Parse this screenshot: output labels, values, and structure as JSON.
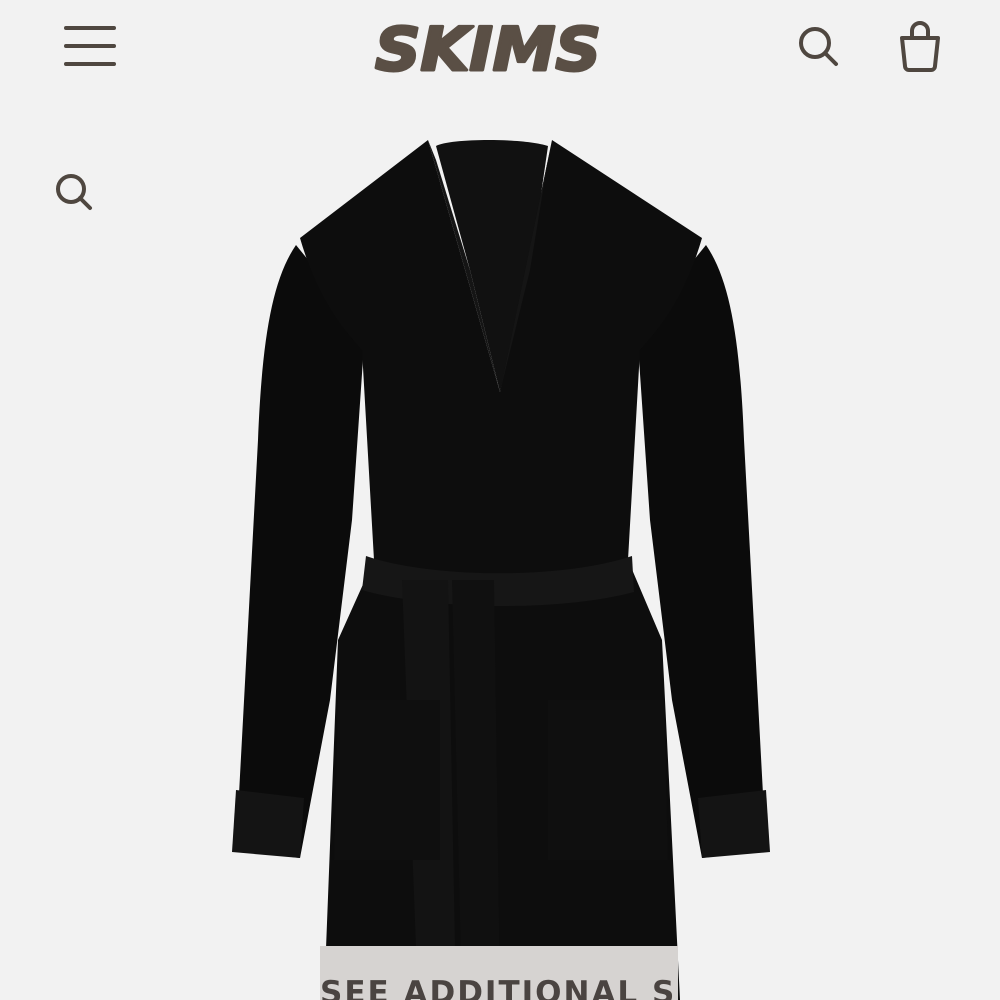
{
  "header": {
    "brand": "SKIMS",
    "menu_icon": "hamburger-menu-icon",
    "search_icon": "search-icon",
    "bag_icon": "shopping-bag-icon"
  },
  "product": {
    "image_alt": "Black belted cardigan robe",
    "sizes_button_label": "SEE ADDITIONAL SIZES"
  },
  "colors": {
    "background": "#f2f2f2",
    "brand_brown": "#5a4f45",
    "icon": "#4f4740",
    "garment": "#0c0c0c",
    "sizes_bar": "#d6d3d1"
  }
}
